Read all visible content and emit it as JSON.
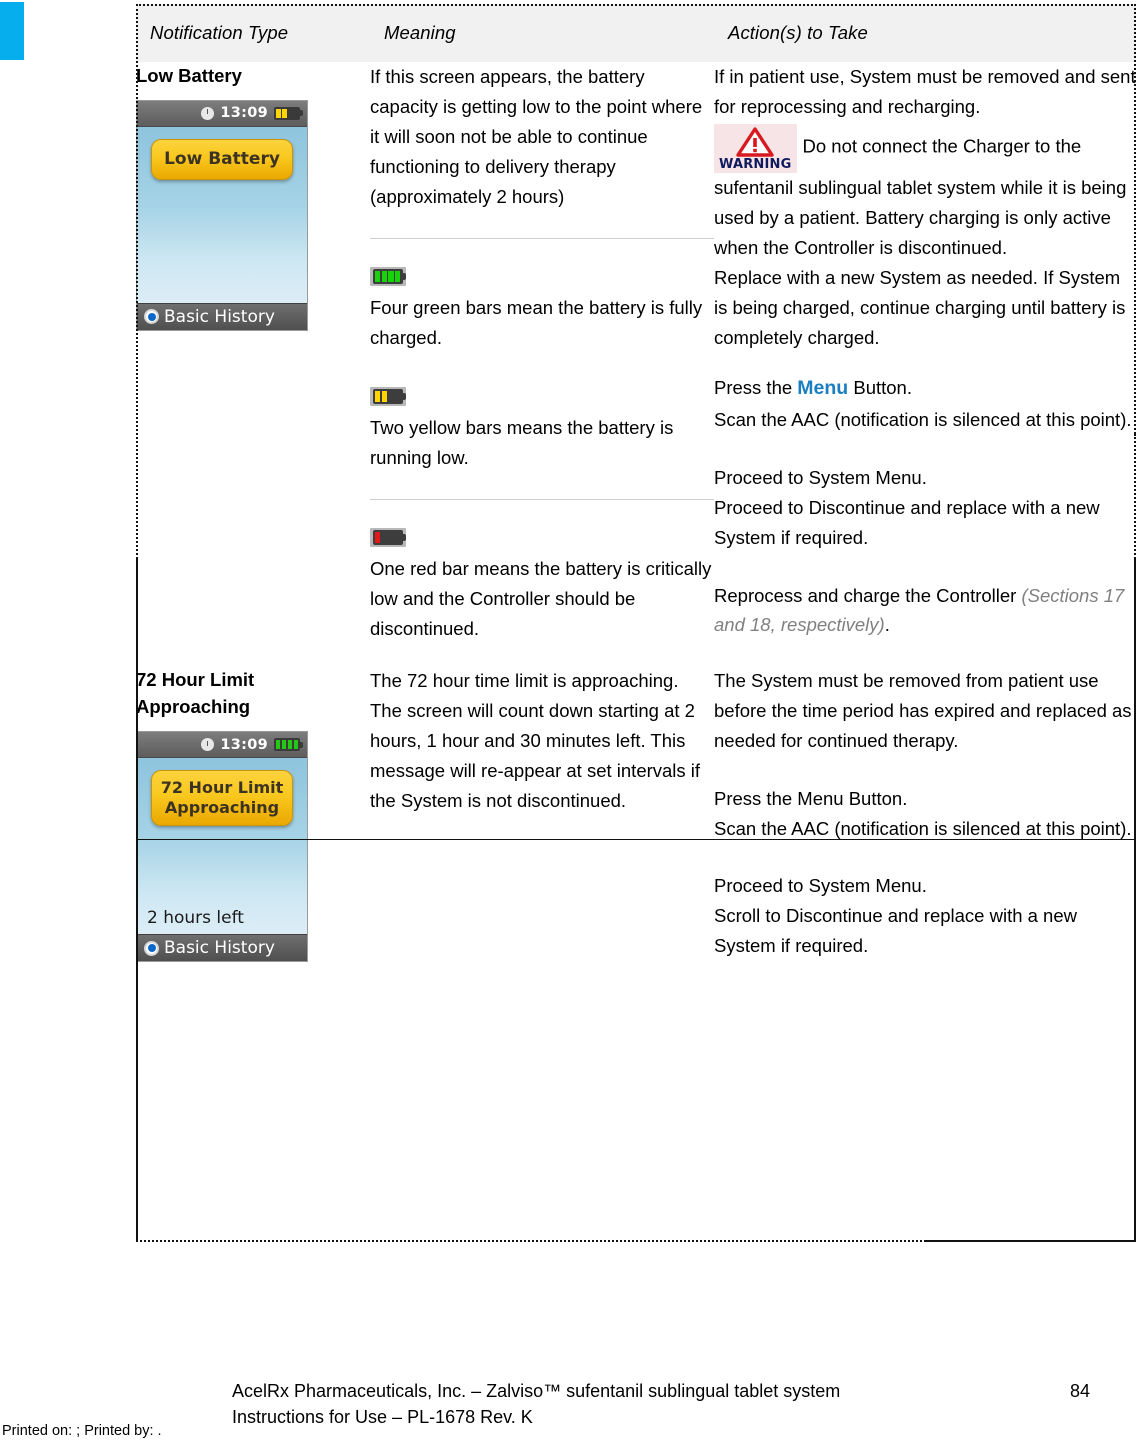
{
  "decor": {
    "accent_color": "#06aeee"
  },
  "table": {
    "headers": [
      "Notification Type",
      "Meaning",
      "Action(s) to Take"
    ],
    "rows": [
      {
        "type_title": "Low Battery",
        "device": {
          "time": "13:09",
          "battery_level": "two-yellow",
          "button_label": "Low Battery",
          "sub_label": "",
          "footer_label": "Basic History"
        },
        "meaning": {
          "paragraph": "If this screen appears, the battery capacity is getting low to the point where it will soon not be able to continue functioning to delivery therapy (approximately 2 hours)",
          "legends": [
            {
              "icon": "battery-four-green-icon",
              "text": "Four green bars mean the battery is fully charged."
            },
            {
              "icon": "battery-two-yellow-icon",
              "text": "Two yellow bars means the battery is running low."
            },
            {
              "icon": "battery-one-red-icon",
              "text": "One red bar means the battery is critically low and the Controller should be discontinued."
            }
          ]
        },
        "action": {
          "lead": "If in patient use, System must be removed and sent for reprocessing and recharging.",
          "warning_word": "WARNING",
          "warning_text": "Do not connect the Charger to the sufentanil sublingual tablet system while it is being used by a patient.  Battery charging is only active when the Controller is discontinued.",
          "replace_text": " Replace with a new System as needed.  If System is being charged, continue charging until battery is completely charged.",
          "press_prefix": "Press the ",
          "press_keyword": "Menu",
          "press_suffix": " Button.",
          "scan_line": "Scan the AAC (notification is silenced at this point).",
          "proceed_line1": "Proceed to System Menu.",
          "proceed_line2": "Proceed to Discontinue and replace with a new System if required.",
          "reprocess_line": "Reprocess and charge the Controller ",
          "sections_note": "(Sections 17 and 18, respectively)",
          "sections_period": "."
        }
      },
      {
        "type_title": "72 Hour Limit Approaching",
        "device": {
          "time": "13:09",
          "battery_level": "four-green",
          "button_label": "72 Hour Limit Approaching",
          "sub_label": "2 hours left",
          "footer_label": "Basic History"
        },
        "meaning": {
          "paragraph": "The 72 hour time limit is approaching. The screen will count down starting at 2 hours, 1 hour  and 30 minutes left.  This message will re-appear at set intervals if the System is not discontinued."
        },
        "action": {
          "lead": "The System must be removed from patient use before the time period has expired and replaced as needed for continued therapy.",
          "press_line": "Press the Menu Button.",
          "scan_line": "Scan the AAC (notification is silenced at this point).",
          "proceed_line1": "Proceed to System Menu.",
          "proceed_line2": "Scroll to Discontinue and replace with a new System if required."
        }
      }
    ]
  },
  "footer": {
    "line1": "AcelRx Pharmaceuticals, Inc. – Zalviso™ sufentanil sublingual tablet system",
    "line2": "Instructions for Use – PL-1678 Rev. K",
    "page_number": "84",
    "printed": "Printed on: ; Printed by: ."
  }
}
